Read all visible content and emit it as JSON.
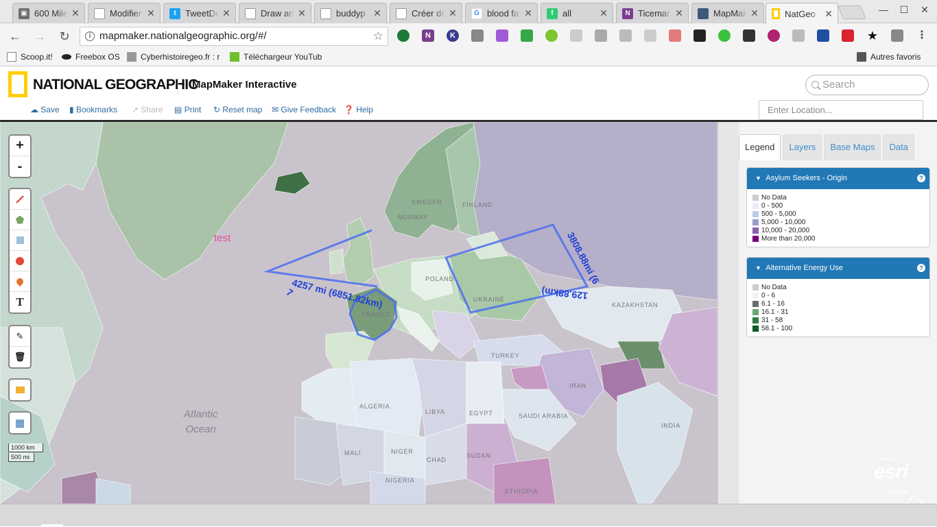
{
  "browser": {
    "tabs": [
      {
        "title": "600 Mile",
        "favicon_color": "#6e6e6e",
        "icon": "image-icon"
      },
      {
        "title": "Modifier",
        "favicon_color": "#9e9e9e",
        "icon": "doc-icon"
      },
      {
        "title": "TweetDe",
        "favicon_color": "#1da1f2",
        "icon": "twitter-icon"
      },
      {
        "title": "Draw an",
        "favicon_color": "#9e9e9e",
        "icon": "doc-icon"
      },
      {
        "title": "buddyp",
        "favicon_color": "#9e9e9e",
        "icon": "doc-icon"
      },
      {
        "title": "Créer de",
        "favicon_color": "#9e9e9e",
        "icon": "doc-icon"
      },
      {
        "title": "blood fa",
        "favicon_color": "#4285f4",
        "icon": "google-icon"
      },
      {
        "title": "all",
        "favicon_color": "#2ecc71",
        "icon": "feedly-icon"
      },
      {
        "title": "Ticemar",
        "favicon_color": "#7a3d8f",
        "icon": "onenote-icon"
      },
      {
        "title": "MapMak",
        "favicon_color": "#3a5a7a",
        "icon": "map-icon"
      },
      {
        "title": "NatGeo",
        "favicon_color": "#ffce00",
        "icon": "natgeo-icon"
      }
    ],
    "close_glyph": "✕",
    "window_controls": {
      "minimize": "—",
      "maximize": "☐",
      "close": "✕"
    },
    "url": "mapmaker.nationalgeographic.org/#/",
    "bookmarks": [
      "Scoop.it!",
      "Freebox OS",
      "Cyberhistoiregeo.fr : r",
      "Téléchargeur YouTub",
      "Autres favoris"
    ]
  },
  "site": {
    "brand": "NATIONAL GEOGRAPHIC",
    "app_title": "MapMaker Interactive",
    "search_placeholder": "Search",
    "location_placeholder": "Enter Location...",
    "menu": [
      {
        "label": "Save",
        "icon": "cloud-icon"
      },
      {
        "label": "Bookmarks",
        "icon": "bookmark-icon"
      },
      {
        "label": "Share",
        "icon": "share-icon"
      },
      {
        "label": "Print",
        "icon": "print-icon"
      },
      {
        "label": "Reset map",
        "icon": "refresh-icon"
      },
      {
        "label": "Give Feedback",
        "icon": "envelope-icon"
      },
      {
        "label": "Help",
        "icon": "help-icon"
      }
    ]
  },
  "map": {
    "zoom_in": "+",
    "zoom_out": "-",
    "text_tool": "T",
    "scale": [
      "1000 km",
      "500 mi"
    ],
    "annotation_text": "test",
    "ocean_label_1": "Atlantic",
    "ocean_label_2": "Ocean",
    "measurements": {
      "france_distance": "4257 mi (6851.82km)",
      "france_prefix": "7",
      "east_side": "3808.88mi (6",
      "east_bottom": "129.88km)"
    },
    "country_labels": [
      "FINLAND",
      "SWEDEN",
      "NORWAY",
      "POLAND",
      "UKRAINE",
      "FRANCE",
      "KAZAKHSTAN",
      "TURKEY",
      "IRAN",
      "ALGERIA",
      "LIBYA",
      "EGYPT",
      "SAUDI ARABIA",
      "MALI",
      "NIGER",
      "CHAD",
      "SUDAN",
      "NIGERIA",
      "ETHIOPIA",
      "INDIA"
    ],
    "attribution_small": "POWERED BY",
    "attribution_esri": "esri",
    "attribution_leaflet": "Leaflet"
  },
  "panel": {
    "tabs": [
      "Legend",
      "Layers",
      "Base Maps",
      "Data"
    ],
    "active_tab": "Legend",
    "legends": [
      {
        "title": "Asylum Seekers - Origin",
        "items": [
          {
            "label": "No Data",
            "color": "#cccccc"
          },
          {
            "label": "0 - 500",
            "color": "#e8eef6"
          },
          {
            "label": "500 - 5,000",
            "color": "#b9cce4"
          },
          {
            "label": "5,000 - 10,000",
            "color": "#9a9cc6"
          },
          {
            "label": "10,000 - 20,000",
            "color": "#8b5fa8"
          },
          {
            "label": "More than 20,000",
            "color": "#7a0177"
          }
        ]
      },
      {
        "title": "Alternative Energy Use",
        "items": [
          {
            "label": "No Data",
            "color": "#cccccc"
          },
          {
            "label": "0 - 6",
            "color": "#eaf6ec"
          },
          {
            "label": "6.1 - 16",
            "color": "#6b6b6b"
          },
          {
            "label": "16.1 - 31",
            "color": "#6fa57a"
          },
          {
            "label": "31 - 58",
            "color": "#2f7a45"
          },
          {
            "label": "58.1 - 100",
            "color": "#0b5a2a"
          }
        ]
      }
    ]
  },
  "colors": {
    "accent_blue": "#2178b5",
    "measure_line": "#4a6ff0",
    "ocean": "#c9c3cb",
    "natgeo_yellow": "#ffce00"
  }
}
